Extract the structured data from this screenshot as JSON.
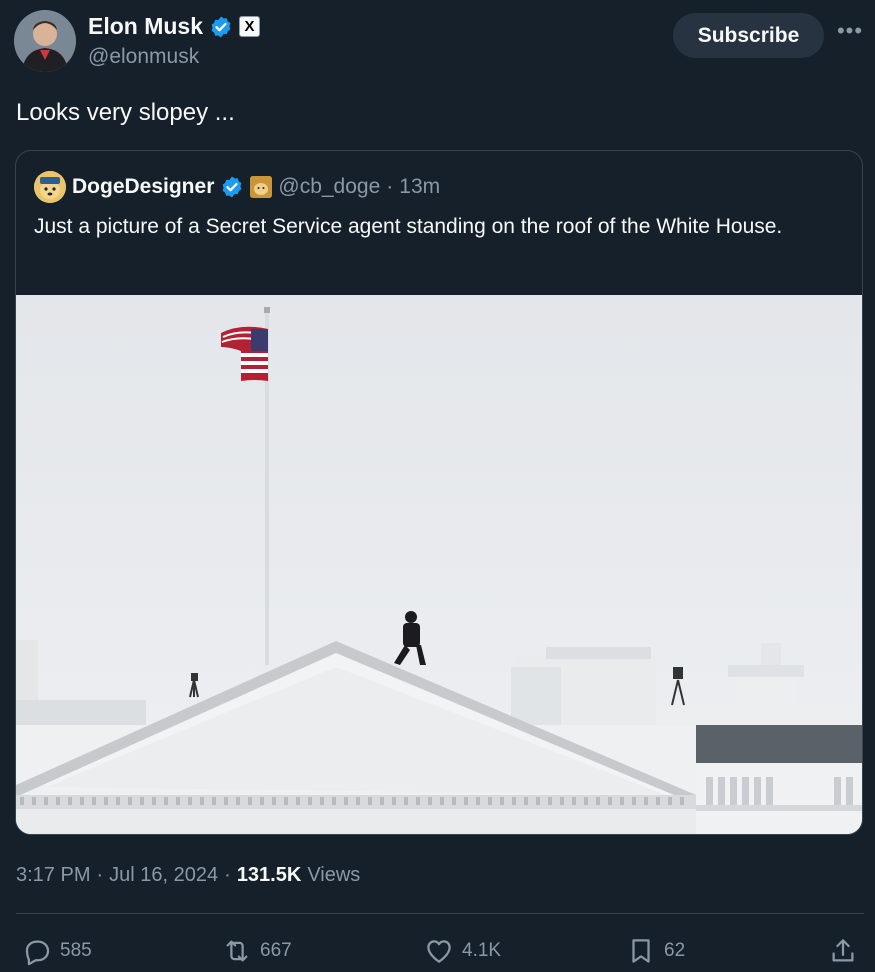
{
  "author": {
    "name": "Elon Musk",
    "handle": "@elonmusk",
    "verified_badge": "verified-check-icon",
    "affiliation_badge": "X"
  },
  "header": {
    "subscribe_label": "Subscribe",
    "more_label": "•••"
  },
  "tweet": {
    "text": "Looks very slopey ..."
  },
  "quote": {
    "name": "DogeDesigner",
    "handle": "@cb_doge",
    "separator": "·",
    "time": "13m",
    "text": "Just a picture of a Secret Service agent standing on the roof of the White House.",
    "photo": "white-house-roof-photo"
  },
  "meta": {
    "time": "3:17 PM",
    "dot1": "·",
    "date": "Jul 16, 2024",
    "dot2": "·",
    "views_count": "131.5K",
    "views_label": "Views"
  },
  "actions": {
    "replies": "585",
    "reposts": "667",
    "likes": "4.1K",
    "bookmarks": "62"
  },
  "colors": {
    "background": "#15202b",
    "text": "#f7f9f9",
    "muted": "#8b98a5",
    "border": "#38444d",
    "verified": "#1d9bf0"
  }
}
